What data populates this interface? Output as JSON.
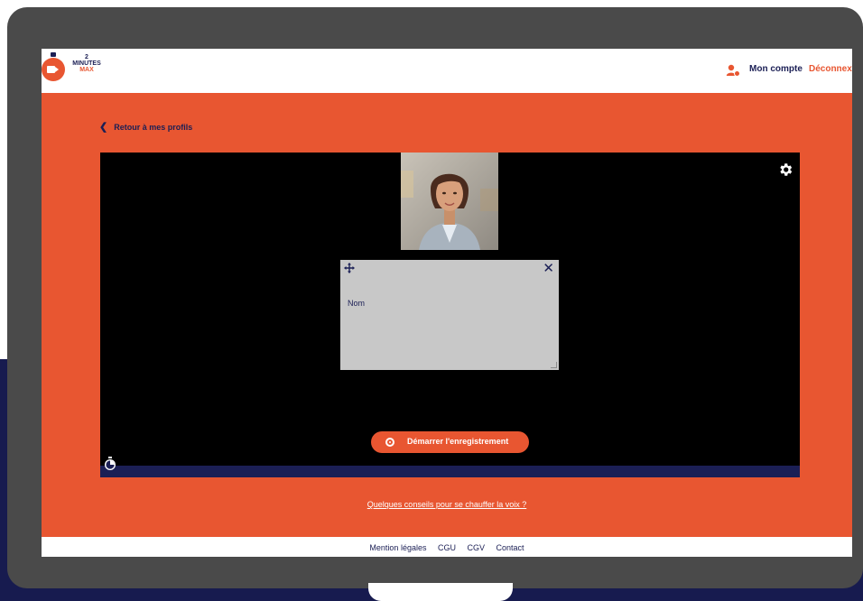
{
  "header": {
    "logo": {
      "line1": "2",
      "line2": "MINUTES",
      "line3": "MAX"
    },
    "account_link": "Mon compte",
    "logout_link": "Déconnexi"
  },
  "nav": {
    "back_label": "Retour à mes profils"
  },
  "recorder": {
    "teleprompter_text": "Nom",
    "record_button_label": "Démarrer l'enregistrement"
  },
  "tips_link": "Quelques conseils pour se chauffer la voix ?",
  "footer": {
    "links": [
      "Mention légales",
      "CGU",
      "CGV",
      "Contact"
    ]
  },
  "colors": {
    "brand_orange": "#e85631",
    "navy": "#1b1f55",
    "frame": "#4a4a4a"
  },
  "icons": [
    "account-icon",
    "chevron-left-icon",
    "gear-icon",
    "move-icon",
    "close-icon",
    "record-icon",
    "timer-icon"
  ]
}
